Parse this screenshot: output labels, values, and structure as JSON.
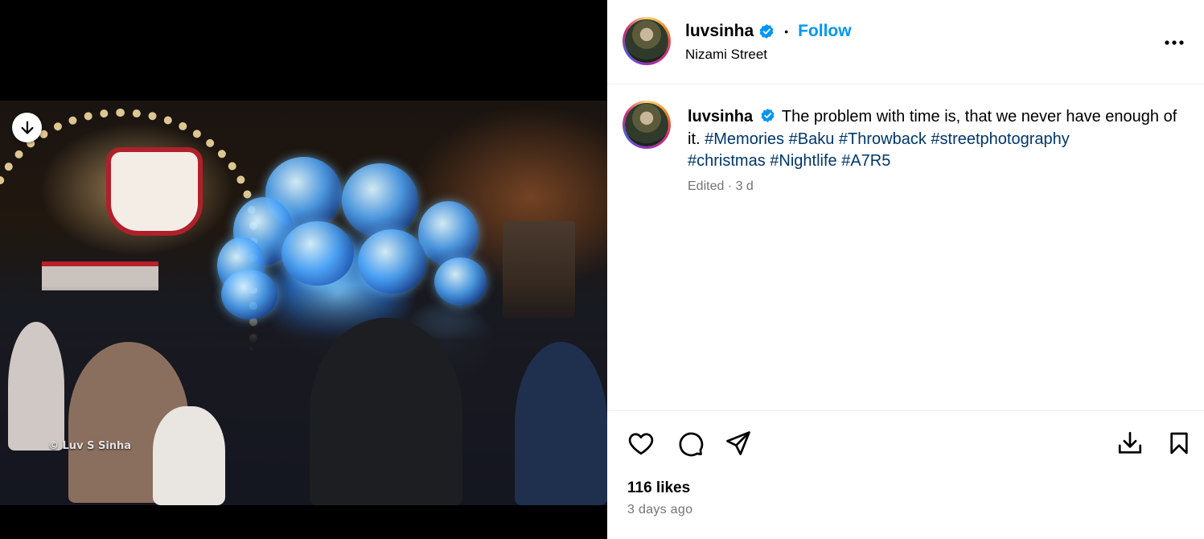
{
  "post": {
    "username": "luvsinha",
    "verified": true,
    "follow_label": "Follow",
    "location": "Nizami Street",
    "photo_watermark": "© Luv S Sinha",
    "caption": {
      "text": "The problem with time is, that we never have enough of it.",
      "hashtags": [
        "#Memories",
        "#Baku",
        "#Throwback",
        "#streetphotography",
        "#christmas",
        "#Nightlife",
        "#A7R5"
      ]
    },
    "meta": "Edited · 3 d",
    "likes": "116 likes",
    "timestamp": "3 days ago"
  },
  "icons": {
    "download_overlay": "arrow-down-circle",
    "more": "more-horizontal",
    "like": "heart-outline",
    "comment": "speech-bubble",
    "share": "paper-plane",
    "save_download": "download-tray",
    "bookmark": "bookmark-outline"
  },
  "colors": {
    "accent": "#0095f6",
    "hashtag": "#00376b",
    "muted": "#737373",
    "verified": "#0095f6"
  }
}
